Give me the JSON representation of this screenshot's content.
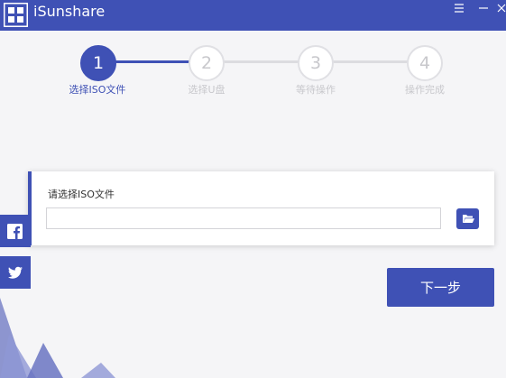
{
  "app": {
    "title": "iSunshare"
  },
  "window": {
    "menu_icon": "hamburger-icon",
    "minimize_icon": "minimize-icon",
    "close_icon": "close-icon"
  },
  "steps": [
    {
      "number": "1",
      "label": "选择ISO文件",
      "active": true
    },
    {
      "number": "2",
      "label": "选择U盘",
      "active": false
    },
    {
      "number": "3",
      "label": "等待操作",
      "active": false
    },
    {
      "number": "4",
      "label": "操作完成",
      "active": false
    }
  ],
  "iso": {
    "label": "请选择ISO文件",
    "value": "",
    "placeholder": "",
    "browse_icon": "folder-open-icon"
  },
  "social": {
    "facebook_icon": "facebook-icon",
    "twitter_icon": "twitter-icon"
  },
  "actions": {
    "next_label": "下一步"
  },
  "colors": {
    "accent": "#3f51b5",
    "inactive": "#c8c8cc",
    "background": "#f5f5f7"
  }
}
